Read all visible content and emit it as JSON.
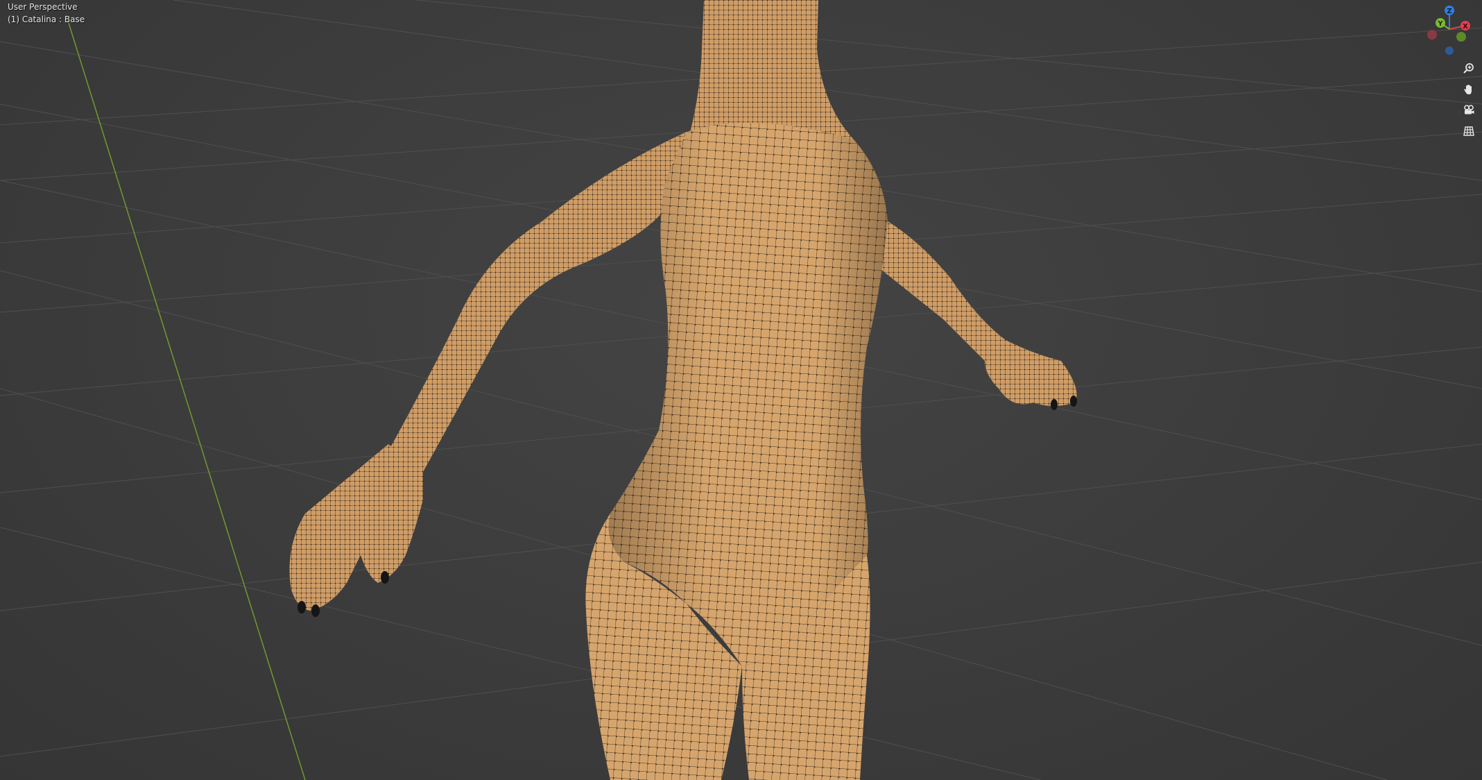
{
  "viewport": {
    "view_name": "User Perspective",
    "object_info": "(1) Catalina : Base"
  },
  "gizmo": {
    "axes": [
      {
        "name": "Z",
        "color": "#2f7fe0"
      },
      {
        "name": "Y",
        "color": "#7cb934"
      },
      {
        "name": "X",
        "color": "#e0404f"
      }
    ]
  },
  "nav_buttons": [
    {
      "name": "zoom",
      "icon": "zoom-icon"
    },
    {
      "name": "pan",
      "icon": "hand-icon"
    },
    {
      "name": "camera",
      "icon": "camera-icon"
    },
    {
      "name": "perspective-toggle",
      "icon": "grid-icon"
    }
  ],
  "colors": {
    "background": "#3d3d3d",
    "grid_line": "#4e4e4e",
    "y_axis_line": "#6f9a2f",
    "mesh_skin": "#d9a66c",
    "wire": "#2a2016"
  }
}
